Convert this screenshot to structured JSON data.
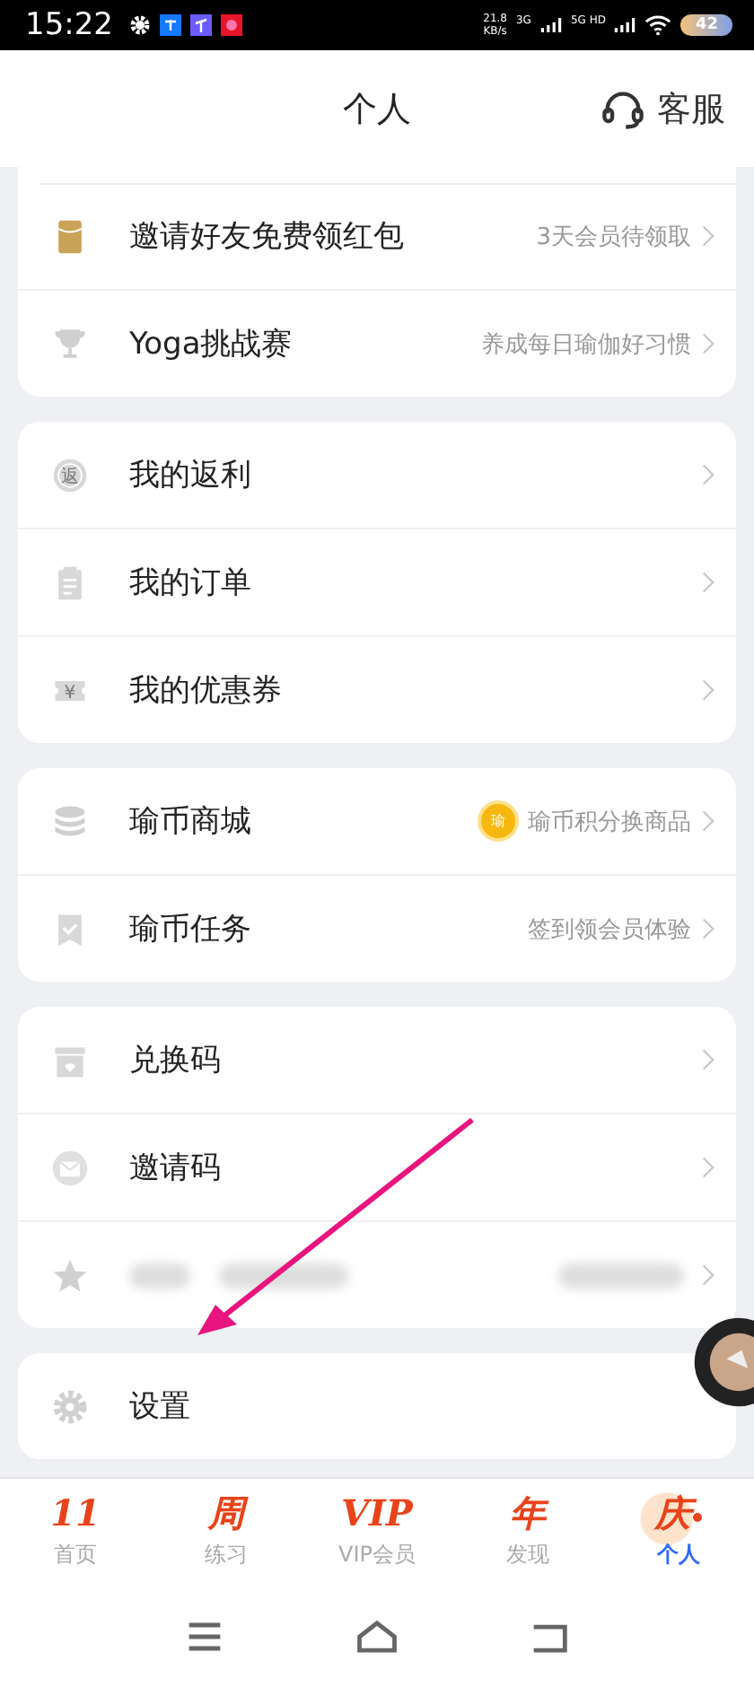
{
  "status_bar": {
    "time": "15:22",
    "speed": "21.8",
    "speed_unit": "KB/s",
    "net_1": "3G",
    "net_2": "5G HD",
    "battery": "42"
  },
  "header": {
    "title": "个人",
    "service": "客服"
  },
  "groups": [
    {
      "cut_top": true,
      "rows": [
        {
          "kind": "redpacket",
          "label": "邀请好友免费领红包",
          "hint": "3天会员待领取"
        },
        {
          "kind": "trophy",
          "label": "Yoga挑战赛",
          "hint": "养成每日瑜伽好习惯"
        }
      ]
    },
    {
      "cut_top": false,
      "rows": [
        {
          "kind": "rebate",
          "label": "我的返利",
          "icon_text": "返"
        },
        {
          "kind": "order",
          "label": "我的订单"
        },
        {
          "kind": "coupon",
          "label": "我的优惠券",
          "icon_text": "¥"
        }
      ]
    },
    {
      "cut_top": false,
      "rows": [
        {
          "kind": "coins",
          "label": "瑜币商城",
          "hint": "瑜币积分换商品",
          "badge": "瑜"
        },
        {
          "kind": "task",
          "label": "瑜币任务",
          "hint": "签到领会员体验"
        }
      ]
    },
    {
      "cut_top": false,
      "rows": [
        {
          "kind": "gift",
          "label": "兑换码"
        },
        {
          "kind": "mail",
          "label": "邀请码"
        },
        {
          "kind": "star",
          "blurred": true
        }
      ]
    },
    {
      "cut_top": false,
      "rows": [
        {
          "kind": "gear",
          "label": "设置"
        }
      ]
    }
  ],
  "tabs": [
    {
      "label": "首页",
      "glyph": "11",
      "selected": false
    },
    {
      "label": "练习",
      "glyph": "周",
      "selected": false
    },
    {
      "label": "VIP会员",
      "glyph": "VIP",
      "selected": false
    },
    {
      "label": "发现",
      "glyph": "年",
      "selected": false
    },
    {
      "label": "个人",
      "glyph": "庆",
      "selected": true
    }
  ]
}
